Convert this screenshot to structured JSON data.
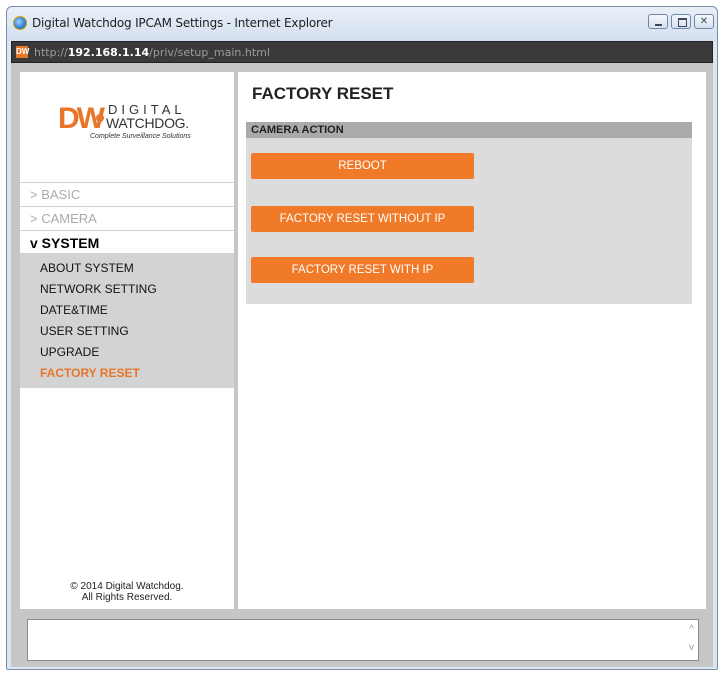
{
  "window": {
    "title": "Digital Watchdog IPCAM Settings - Internet Explorer",
    "close_glyph": "✕"
  },
  "address": {
    "prefix": "http://",
    "host": "192.168.1.14",
    "path": "/priv/setup_main.html",
    "icon_text": "DW"
  },
  "logo": {
    "mark": "DW",
    "line1": "DIGITAL",
    "line2": "WATCHDOG.",
    "tagline": "Complete Surveillance Solutions"
  },
  "sidebar": {
    "menu": [
      {
        "label": "> BASIC"
      },
      {
        "label": "> CAMERA"
      },
      {
        "label": "v SYSTEM"
      }
    ],
    "submenu": [
      {
        "label": "ABOUT SYSTEM"
      },
      {
        "label": "NETWORK SETTING"
      },
      {
        "label": "DATE&TIME"
      },
      {
        "label": "USER SETTING"
      },
      {
        "label": "UPGRADE"
      },
      {
        "label": "FACTORY RESET"
      }
    ],
    "copyright_line1": "© 2014 Digital Watchdog.",
    "copyright_line2": "All Rights Reserved."
  },
  "main": {
    "title": "FACTORY RESET",
    "panel_title": "CAMERA ACTION",
    "buttons": {
      "reboot": "REBOOT",
      "reset_without_ip": "FACTORY RESET WITHOUT IP",
      "reset_with_ip": "FACTORY RESET WITH IP"
    }
  },
  "status": {
    "scroll_up": "^",
    "scroll_down": "v"
  },
  "colors": {
    "accent": "#f07a28",
    "panel": "#dcdcdc",
    "frame": "#c6c6c6"
  }
}
